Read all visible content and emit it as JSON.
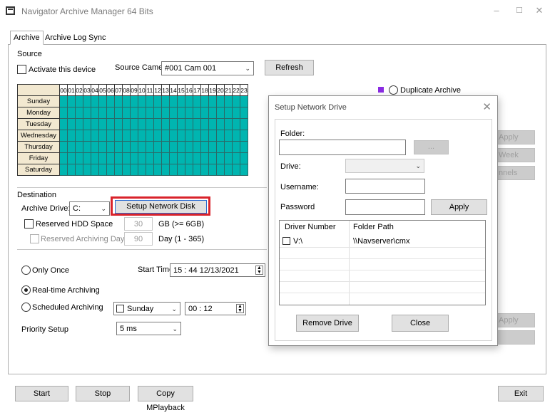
{
  "window": {
    "title": "Navigator Archive Manager 64 Bits",
    "min": "–",
    "max": "☐",
    "close": "✕"
  },
  "tabs": [
    {
      "label": "Archive"
    },
    {
      "label": "Archive Log"
    },
    {
      "label": "Sync"
    }
  ],
  "source": {
    "group_label": "Source",
    "activate_label": "Activate this device",
    "camera_label": "Source Camera:",
    "camera_value": "#001  Cam 001",
    "refresh_label": "Refresh"
  },
  "schedule": {
    "hours": [
      "00",
      "01",
      "02",
      "03",
      "04",
      "05",
      "06",
      "07",
      "08",
      "09",
      "10",
      "11",
      "12",
      "13",
      "14",
      "15",
      "16",
      "17",
      "18",
      "19",
      "20",
      "21",
      "22",
      "23"
    ],
    "days": [
      "Sunday",
      "Monday",
      "Tuesday",
      "Wednesday",
      "Thursday",
      "Friday",
      "Saturday"
    ],
    "cell_color": "#00b5b0"
  },
  "right_side": {
    "duplicate_archive_label": "Duplicate Archive",
    "apply_label": "Apply",
    "week_label": "Week",
    "channels_label": "nnels",
    "apply2_label": "Apply"
  },
  "destination": {
    "group_label": "Destination",
    "drive_label": "Archive Drive:",
    "drive_value": "C:",
    "setup_network_label": "Setup Network Disk",
    "reserved_hdd_label": "Reserved HDD Space",
    "reserved_hdd_value": "30",
    "reserved_hdd_unit": "GB (>= 6GB)",
    "reserved_days_label": "Reserved Archiving Days",
    "reserved_days_value": "90",
    "reserved_days_unit": "Day (1 - 365)"
  },
  "mode": {
    "only_once_label": "Only Once",
    "start_time_label": "Start Time",
    "start_time_value": "15 : 44   12/13/2021",
    "realtime_label": "Real-time Archiving",
    "scheduled_label": "Scheduled Archiving",
    "scheduled_day": "Sunday",
    "scheduled_time": "00 : 12",
    "priority_label": "Priority Setup",
    "priority_value": "5 ms"
  },
  "footer": {
    "start_label": "Start",
    "stop_label": "Stop",
    "copy_label": "Copy MPlayback",
    "exit_label": "Exit"
  },
  "dialog": {
    "title": "Setup Network Drive",
    "folder_label": "Folder:",
    "folder_value": "",
    "browse_label": "...",
    "drive_label": "Drive:",
    "username_label": "Username:",
    "password_label": "Password",
    "apply_label": "Apply",
    "columns": [
      "Driver Number",
      "Folder Path"
    ],
    "rows": [
      {
        "drive": "V:\\",
        "path": "\\\\Navserver\\cmx"
      }
    ],
    "remove_label": "Remove Drive",
    "close_label": "Close"
  },
  "colors": {
    "highlight": "#d9232b",
    "accent_purple": "#8a2be2"
  }
}
